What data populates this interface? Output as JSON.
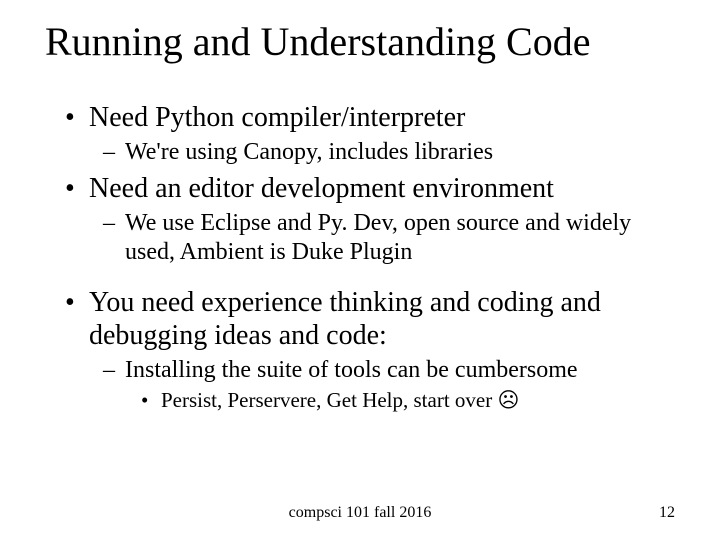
{
  "title": "Running and Understanding Code",
  "bullets": {
    "b1": "Need Python compiler/interpreter",
    "b1_1": "We're using Canopy, includes libraries",
    "b2": "Need an editor development environment",
    "b2_1": "We use Eclipse and Py. Dev, open source and widely used, Ambient is Duke Plugin",
    "b3": "You need experience thinking and coding and debugging ideas and code:",
    "b3_1": "Installing the suite of tools can be cumbersome",
    "b3_1_1": "Persist, Perservere, Get Help, start over ☹"
  },
  "footer": {
    "center": "compsci 101 fall 2016",
    "page": "12"
  }
}
